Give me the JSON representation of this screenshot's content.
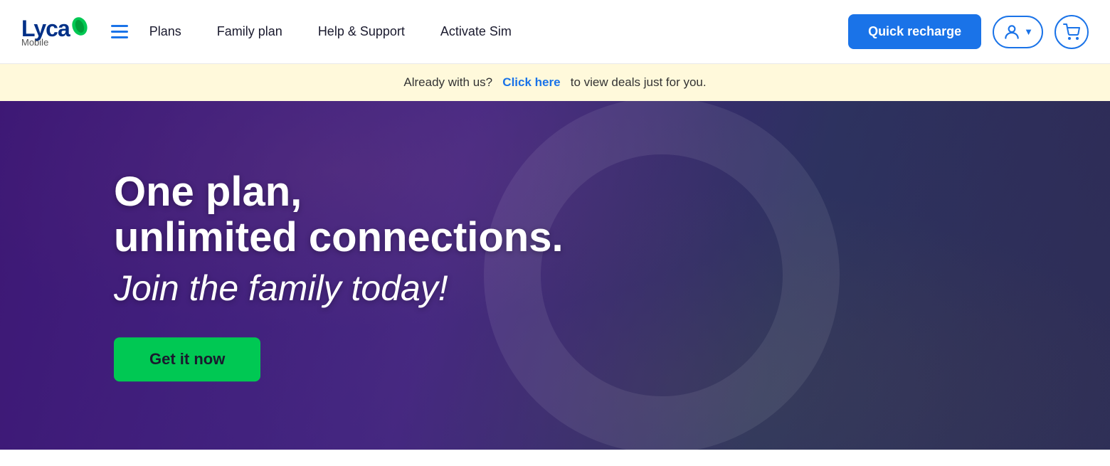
{
  "brand": {
    "name_part1": "Lyca",
    "name_part2": "Mobile",
    "leaf_color": "#00c853"
  },
  "navbar": {
    "hamburger_label": "Menu",
    "links": [
      {
        "id": "plans",
        "label": "Plans"
      },
      {
        "id": "family-plan",
        "label": "Family plan"
      },
      {
        "id": "help-support",
        "label": "Help & Support"
      },
      {
        "id": "activate-sim",
        "label": "Activate Sim"
      }
    ],
    "quick_recharge_label": "Quick recharge",
    "account_label": "Account",
    "cart_label": "Cart"
  },
  "promo_banner": {
    "text_before": "Already with us?",
    "link_text": "Click here",
    "text_after": "to view deals just for you."
  },
  "hero": {
    "headline": "One plan,",
    "headline2": "unlimited connections.",
    "subheadline": "Join the family today!",
    "cta_label": "Get it now"
  }
}
